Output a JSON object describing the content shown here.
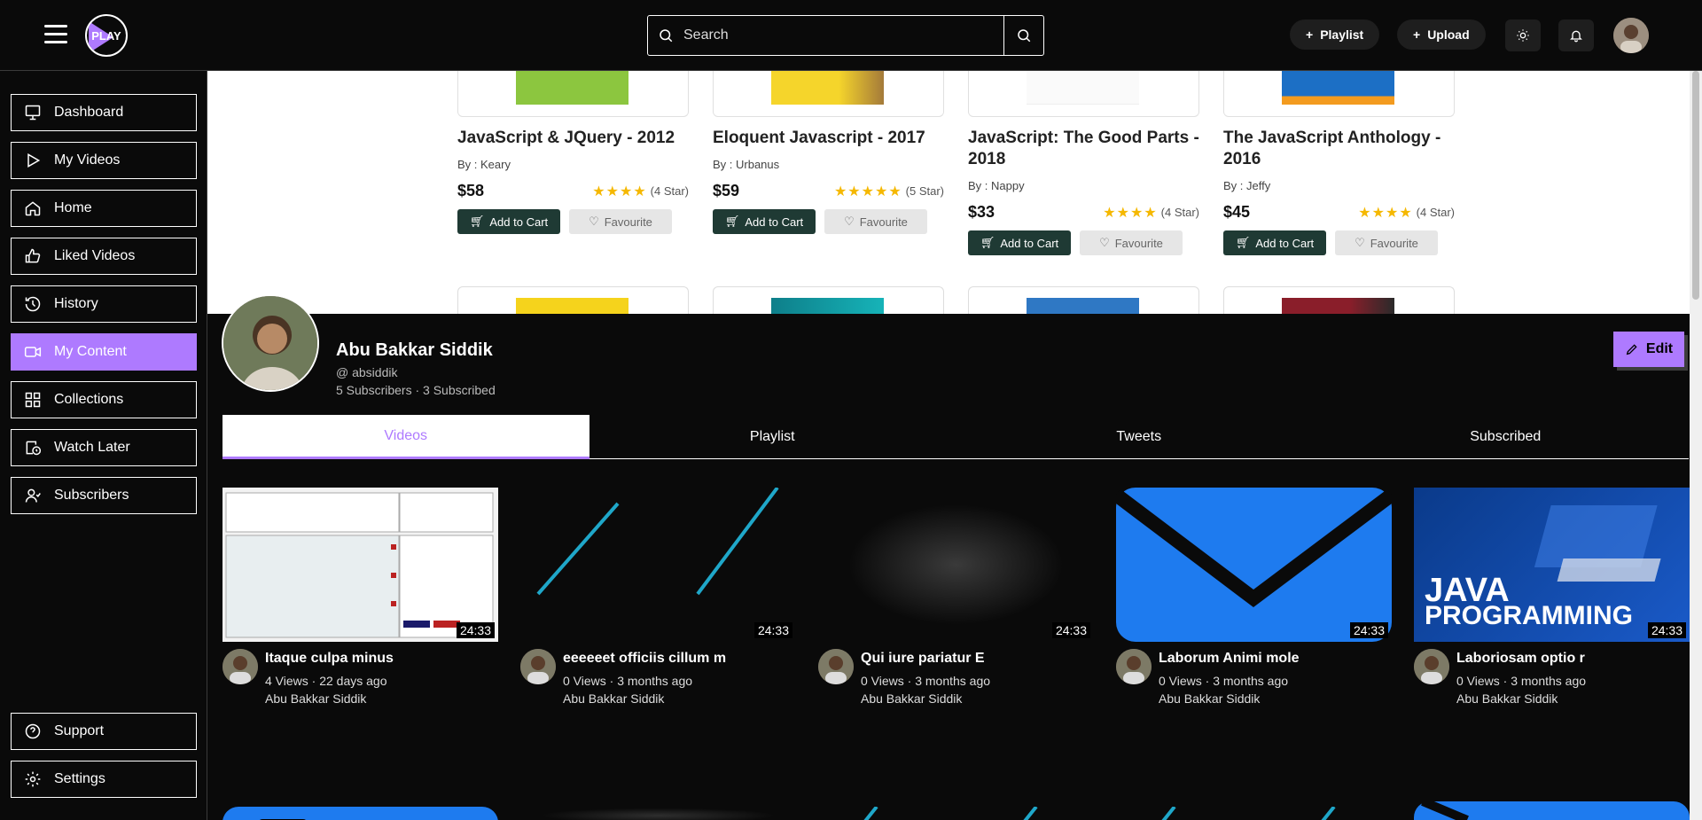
{
  "header": {
    "logo_text": "PLAY",
    "search_placeholder": "Search",
    "playlist_label": "Playlist",
    "upload_label": "Upload"
  },
  "sidebar": {
    "items": [
      {
        "label": "Dashboard",
        "icon": "dashboard-icon"
      },
      {
        "label": "My Videos",
        "icon": "play-icon"
      },
      {
        "label": "Home",
        "icon": "home-icon"
      },
      {
        "label": "Liked Videos",
        "icon": "thumbs-up-icon"
      },
      {
        "label": "History",
        "icon": "history-icon"
      },
      {
        "label": "My Content",
        "icon": "video-camera-icon"
      },
      {
        "label": "Collections",
        "icon": "collections-icon"
      },
      {
        "label": "Watch Later",
        "icon": "watch-later-icon"
      },
      {
        "label": "Subscribers",
        "icon": "subscribers-icon"
      }
    ],
    "bottom": [
      {
        "label": "Support",
        "icon": "support-icon"
      },
      {
        "label": "Settings",
        "icon": "settings-icon"
      }
    ],
    "active": "My Content",
    "accent_color": "#ae7aff"
  },
  "books": [
    {
      "title": "JavaScript & JQuery - 2012",
      "author": "By : Keary",
      "price": "$58",
      "rating": "(4 Star)",
      "stars": 4,
      "cart": "Add to Cart",
      "fav": "Favourite"
    },
    {
      "title": "Eloquent Javascript - 2017",
      "author": "By : Urbanus",
      "price": "$59",
      "rating": "(5 Star)",
      "stars": 5,
      "cart": "Add to Cart",
      "fav": "Favourite"
    },
    {
      "title": "JavaScript: The Good Parts - 2018",
      "author": "By : Nappy",
      "price": "$33",
      "rating": "(4 Star)",
      "stars": 4,
      "cart": "Add to Cart",
      "fav": "Favourite"
    },
    {
      "title": "The JavaScript Anthology - 2016",
      "author": "By : Jeffy",
      "price": "$45",
      "rating": "(4 Star)",
      "stars": 4,
      "cart": "Add to Cart",
      "fav": "Favourite"
    }
  ],
  "profile": {
    "name": "Abu Bakkar Siddik",
    "handle": "@ absiddik",
    "stats": "5 Subscribers · 3 Subscribed",
    "edit_label": "Edit"
  },
  "tabs": [
    "Videos",
    "Playlist",
    "Tweets",
    "Subscribed"
  ],
  "active_tab": "Videos",
  "videos": [
    {
      "title": "Itaque culpa minus",
      "info": "4 Views · 22 days ago",
      "channel": "Abu Bakkar Siddik",
      "duration": "24:33"
    },
    {
      "title": "eeeeeet officiis cillum m",
      "info": "0 Views · 3 months ago",
      "channel": "Abu Bakkar Siddik",
      "duration": "24:33"
    },
    {
      "title": "Qui iure pariatur E",
      "info": "0 Views · 3 months ago",
      "channel": "Abu Bakkar Siddik",
      "duration": "24:33"
    },
    {
      "title": "Laborum Animi mole",
      "info": "0 Views · 3 months ago",
      "channel": "Abu Bakkar Siddik",
      "duration": "24:33"
    },
    {
      "title": "Laboriosam optio r",
      "info": "0 Views · 3 months ago",
      "channel": "Abu Bakkar Siddik",
      "duration": "24:33"
    }
  ],
  "java_thumb": {
    "line1": "JAVA",
    "line2": "PROGRAMMING"
  }
}
